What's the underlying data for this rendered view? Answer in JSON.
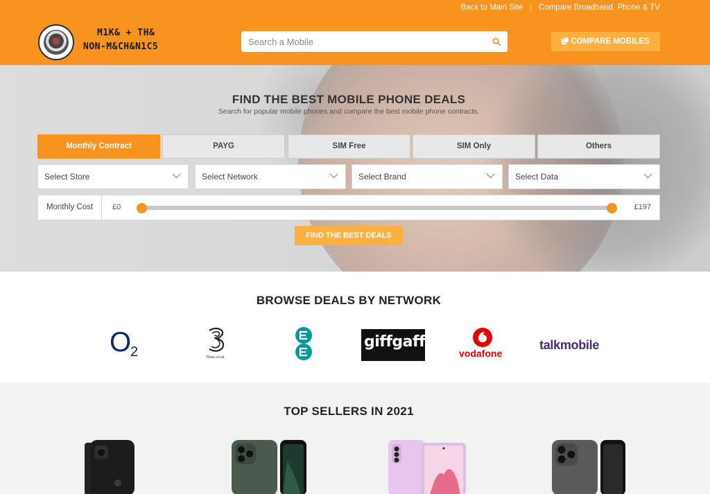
{
  "topbar": {
    "link_main": "Back to Main Site",
    "separator": "|",
    "link_broadband": "Compare Broadband, Phone & TV"
  },
  "header": {
    "logo_line1": "M1K& + TH&",
    "logo_line2": "NON-M&CH&N1C5",
    "search_placeholder": "Search a Mobile",
    "compare_label": "COMPARE MOBILES"
  },
  "hero": {
    "title": "FIND THE BEST MOBILE PHONE DEALS",
    "subtitle": "Search for popular mobile phones and compare the best mobile phone contracts.",
    "tabs": [
      {
        "label": "Monthly Contract",
        "active": true
      },
      {
        "label": "PAYG",
        "active": false
      },
      {
        "label": "SIM Free",
        "active": false
      },
      {
        "label": "SIM Only",
        "active": false
      },
      {
        "label": "Others",
        "active": false
      }
    ],
    "selects": [
      "Select Store",
      "Select Network",
      "Select Brand",
      "Select Data"
    ],
    "range": {
      "label": "Monthly Cost",
      "min_label": "£0",
      "max_label": "£197",
      "min_value": 0,
      "max_value": 197
    },
    "find_label": "FIND THE BEST DEALS"
  },
  "networks": {
    "title": "BROWSE DEALS BY NETWORK",
    "o2": "O",
    "o2_sub": "2",
    "three_small": "Three.co.uk",
    "giffgaff": "giffgaff",
    "vodafone": "vodafone",
    "talkmobile": "talkmobile"
  },
  "sellers": {
    "title": "TOP SELLERS IN 2021"
  },
  "colors": {
    "brand_orange": "#f7931e",
    "button_orange": "#fbb040"
  }
}
